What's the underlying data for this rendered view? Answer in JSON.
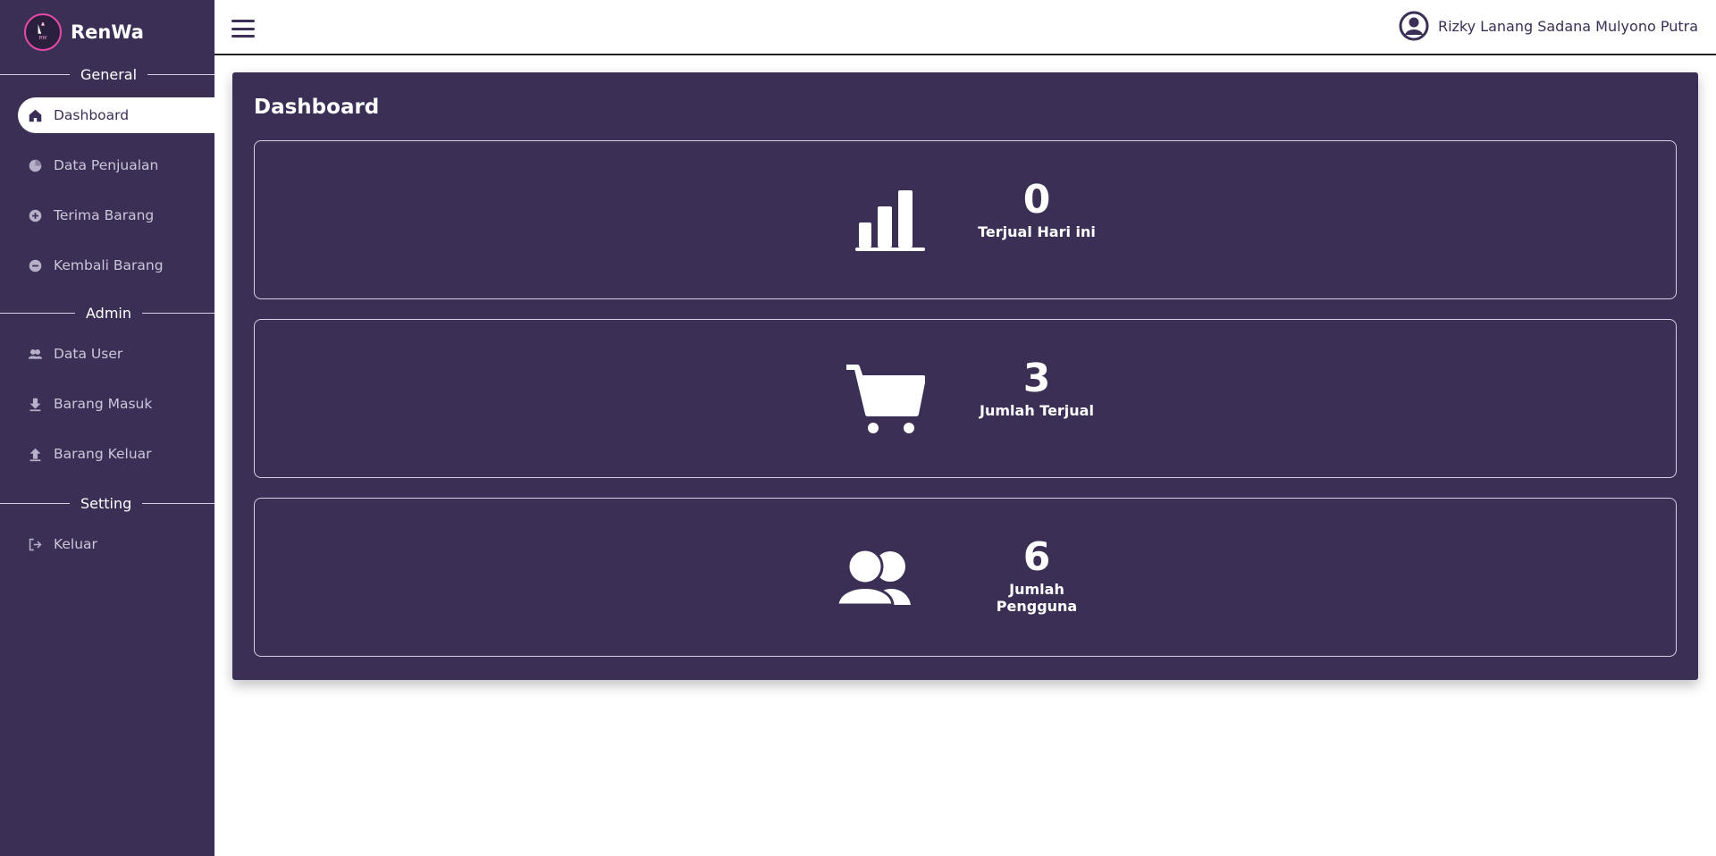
{
  "brand": {
    "name": "RenWa"
  },
  "sidebar": {
    "sections": [
      {
        "label": "General"
      },
      {
        "label": "Admin"
      },
      {
        "label": "Setting"
      }
    ],
    "items": [
      {
        "label": "Dashboard",
        "icon": "home-icon"
      },
      {
        "label": "Data Penjualan",
        "icon": "pie-chart-icon"
      },
      {
        "label": "Terima Barang",
        "icon": "plus-circle-icon"
      },
      {
        "label": "Kembali Barang",
        "icon": "minus-circle-icon"
      },
      {
        "label": "Data User",
        "icon": "users-icon"
      },
      {
        "label": "Barang Masuk",
        "icon": "arrow-down-icon"
      },
      {
        "label": "Barang Keluar",
        "icon": "arrow-up-icon"
      },
      {
        "label": "Keluar",
        "icon": "logout-icon"
      }
    ]
  },
  "topbar": {
    "user_name": "Rizky Lanang Sadana Mulyono Putra"
  },
  "main": {
    "title": "Dashboard",
    "stats": [
      {
        "value": "0",
        "label": "Terjual Hari ini",
        "icon": "bar-chart-icon"
      },
      {
        "value": "3",
        "label": "Jumlah Terjual",
        "icon": "cart-icon"
      },
      {
        "value": "6",
        "label": "Jumlah Pengguna",
        "icon": "users-icon"
      }
    ]
  },
  "colors": {
    "primary": "#3b2f55",
    "accent": "#e94aa8",
    "text_light": "#ffffff"
  }
}
